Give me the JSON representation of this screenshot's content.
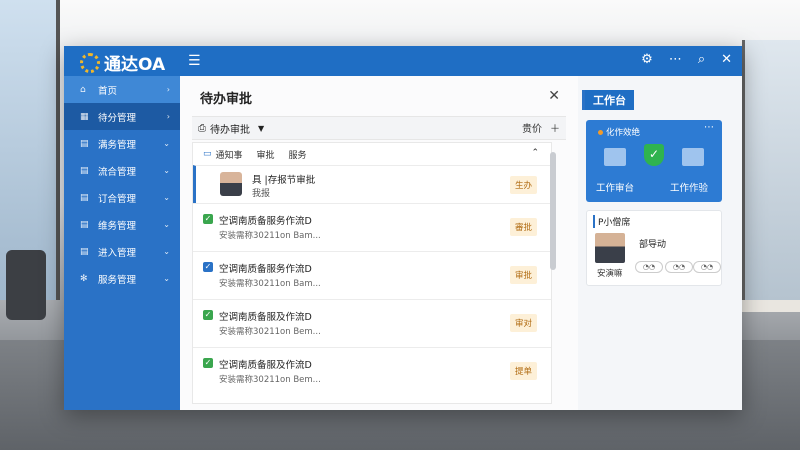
{
  "app": {
    "brand": "通达OA"
  },
  "sidebar": {
    "items": [
      {
        "label": "首页",
        "icon": "home-icon",
        "state": "active"
      },
      {
        "label": "待分管理",
        "icon": "grid-icon",
        "state": "selected"
      },
      {
        "label": "满务管理",
        "icon": "list-icon",
        "state": "normal"
      },
      {
        "label": "流合管理",
        "icon": "document-icon",
        "state": "normal"
      },
      {
        "label": "订合管理",
        "icon": "list-icon",
        "state": "normal"
      },
      {
        "label": "维务管理",
        "icon": "list-icon",
        "state": "normal"
      },
      {
        "label": "进入管理",
        "icon": "list-icon",
        "state": "normal"
      },
      {
        "label": "服务管理",
        "icon": "gear-icon",
        "state": "normal"
      }
    ]
  },
  "panel": {
    "title": "待办审批",
    "filter_label": "待办审批",
    "toolbar_right_text": "贵价",
    "list_headers": [
      "通知事",
      "审批",
      "服务"
    ],
    "first_row": {
      "title": "具 |存报节审批",
      "sub": "我报",
      "status": "生办"
    },
    "rows": [
      {
        "title": "空调南质备服务作流D",
        "sub": "安装需称30211on Bam...",
        "status": "審批",
        "check": "green"
      },
      {
        "title": "空调南质备服务作流D",
        "sub": "安装需称30211on Bam...",
        "status": "审批",
        "check": "blue"
      },
      {
        "title": "空调南质备服及作流D",
        "sub": "安装需称30211on Bem...",
        "status": "审对",
        "check": "green"
      },
      {
        "title": "空调南质备服及作流D",
        "sub": "安装需称30211on Bem...",
        "status": "提单",
        "check": "green"
      }
    ]
  },
  "workbench": {
    "title": "工作台",
    "card1": {
      "header": "化作效绝",
      "left_label": "工作审台",
      "right_label": "工作作验"
    },
    "card2": {
      "header": "P小僧席",
      "name": "部导动",
      "sub": "安演嘛"
    }
  },
  "colors": {
    "brand_blue": "#1f6ec4",
    "sidebar_blue": "#2a72c6",
    "badge_bg": "#fdf0d8",
    "check_green": "#3aa64e"
  }
}
